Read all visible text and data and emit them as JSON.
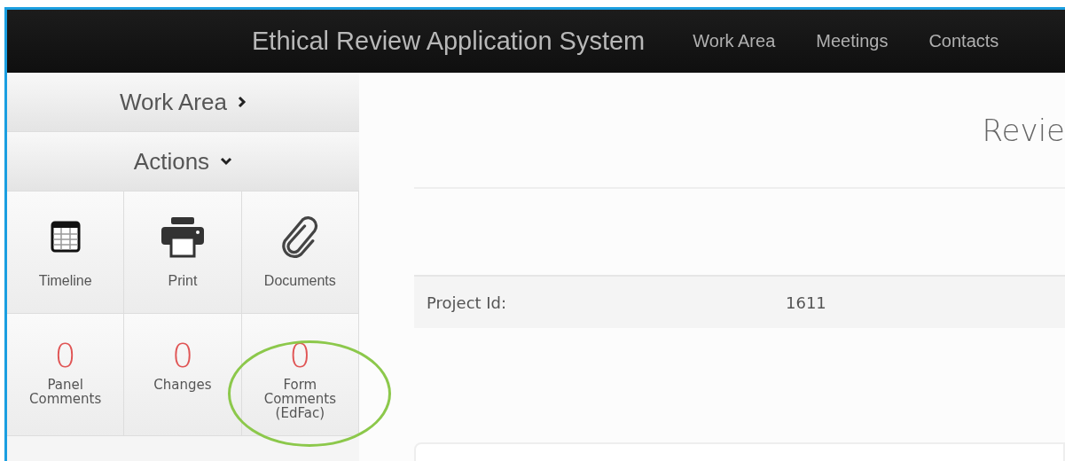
{
  "header": {
    "title": "Ethical Review Application System",
    "nav": [
      "Work Area",
      "Meetings",
      "Contacts"
    ]
  },
  "sidebar": {
    "sections": [
      {
        "label": "Work Area",
        "expanded": false
      },
      {
        "label": "Actions",
        "expanded": true
      }
    ],
    "tiles": [
      {
        "kind": "icon",
        "label": "Timeline"
      },
      {
        "kind": "icon",
        "label": "Print"
      },
      {
        "kind": "icon",
        "label": "Documents"
      },
      {
        "kind": "count",
        "count": "0",
        "label": "Panel Comments"
      },
      {
        "kind": "count",
        "count": "0",
        "label": "Changes"
      },
      {
        "kind": "count",
        "count": "0",
        "label": "Form Comments (EdFac)",
        "highlighted": true
      }
    ]
  },
  "main": {
    "heading": "Revie",
    "fields": [
      {
        "label": "Project Id:",
        "value": "1611"
      }
    ]
  }
}
